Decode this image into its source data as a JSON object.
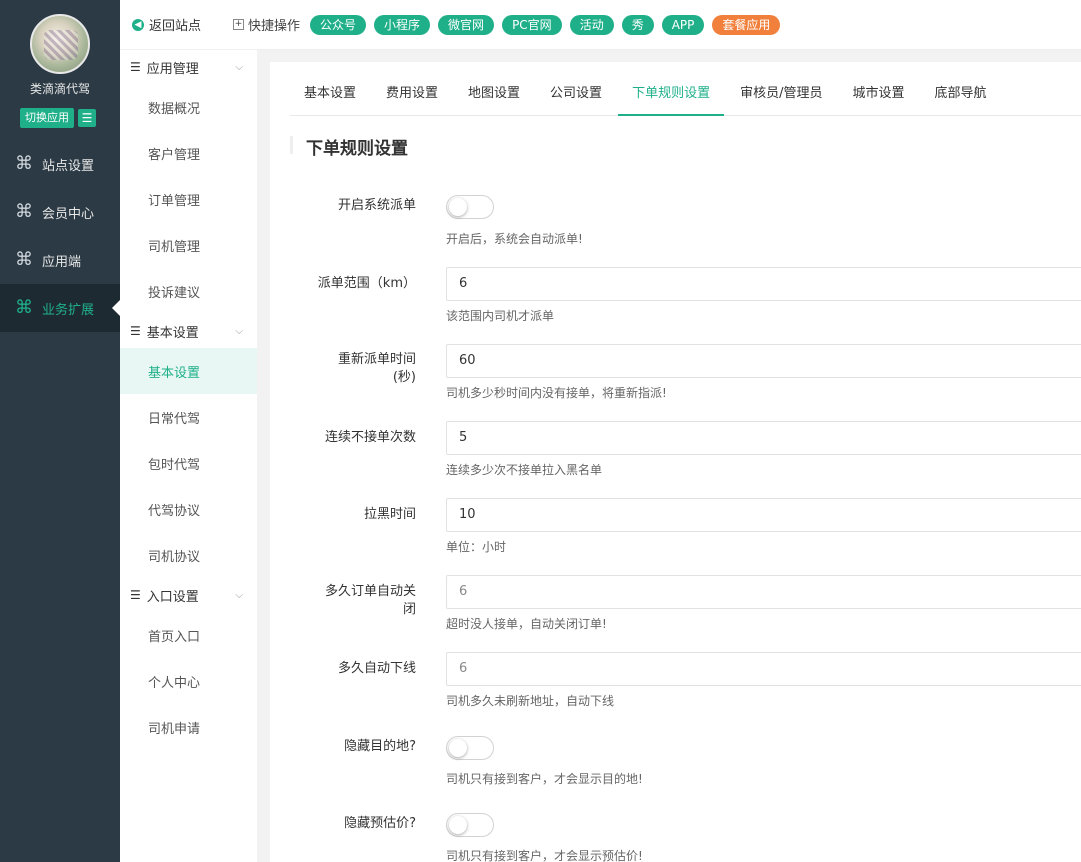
{
  "site": {
    "name": "类滴滴代驾",
    "switch_label": "切换应用",
    "list_icon": "list-icon"
  },
  "dark_nav": [
    {
      "label": "站点设置",
      "icon": "cluster-icon"
    },
    {
      "label": "会员中心",
      "icon": "cluster-icon"
    },
    {
      "label": "应用端",
      "icon": "cluster-icon"
    },
    {
      "label": "业务扩展",
      "icon": "cluster-icon",
      "active": true
    }
  ],
  "back": {
    "label": "返回站点"
  },
  "menu": {
    "groups": [
      {
        "title": "应用管理",
        "items": [
          "数据概况",
          "客户管理",
          "订单管理",
          "司机管理",
          "投诉建议"
        ]
      },
      {
        "title": "基本设置",
        "items": [
          "基本设置",
          "日常代驾",
          "包时代驾",
          "代驾协议",
          "司机协议"
        ]
      },
      {
        "title": "入口设置",
        "items": [
          "首页入口",
          "个人中心",
          "司机申请"
        ]
      }
    ],
    "active_item": "基本设置"
  },
  "topbar": {
    "quick_label": "快捷操作",
    "pills": [
      "公众号",
      "小程序",
      "微官网",
      "PC官网",
      "活动",
      "秀",
      "APP",
      "套餐应用"
    ],
    "colors": {
      "green": "#1fb08a",
      "orange": "#f0803c"
    }
  },
  "tabs": [
    "基本设置",
    "费用设置",
    "地图设置",
    "公司设置",
    "下单规则设置",
    "审核员/管理员",
    "城市设置",
    "底部导航"
  ],
  "active_tab": "下单规则设置",
  "section_title": "下单规则设置",
  "form": {
    "auto_dispatch": {
      "label": "开启系统派单",
      "enabled": false,
      "help": "开启后，系统会自动派单!"
    },
    "dispatch_range": {
      "label": "派单范围（km）",
      "value": "6",
      "help": "该范围内司机才派单"
    },
    "redispatch_time": {
      "label1": "重新派单时间",
      "label2": "(秒)",
      "value": "60",
      "help": "司机多少秒时间内没有接单，将重新指派!"
    },
    "consecutive_reject": {
      "label": "连续不接单次数",
      "value": "5",
      "help": "连续多少次不接单拉入黑名单"
    },
    "block_time": {
      "label": "拉黑时间",
      "value": "10",
      "help": "单位：小时"
    },
    "auto_close": {
      "label1": "多久订单自动关",
      "label2": "闭",
      "value": "6",
      "help": "超时没人接单，自动关闭订单!"
    },
    "auto_offline": {
      "label": "多久自动下线",
      "value": "6",
      "help": "司机多久未刷新地址，自动下线"
    },
    "hide_destination": {
      "label": "隐藏目的地?",
      "enabled": false,
      "help": "司机只有接到客户，才会显示目的地!"
    },
    "hide_estimate": {
      "label": "隐藏预估价?",
      "enabled": false,
      "help": "司机只有接到客户，才会显示预估价!"
    }
  }
}
